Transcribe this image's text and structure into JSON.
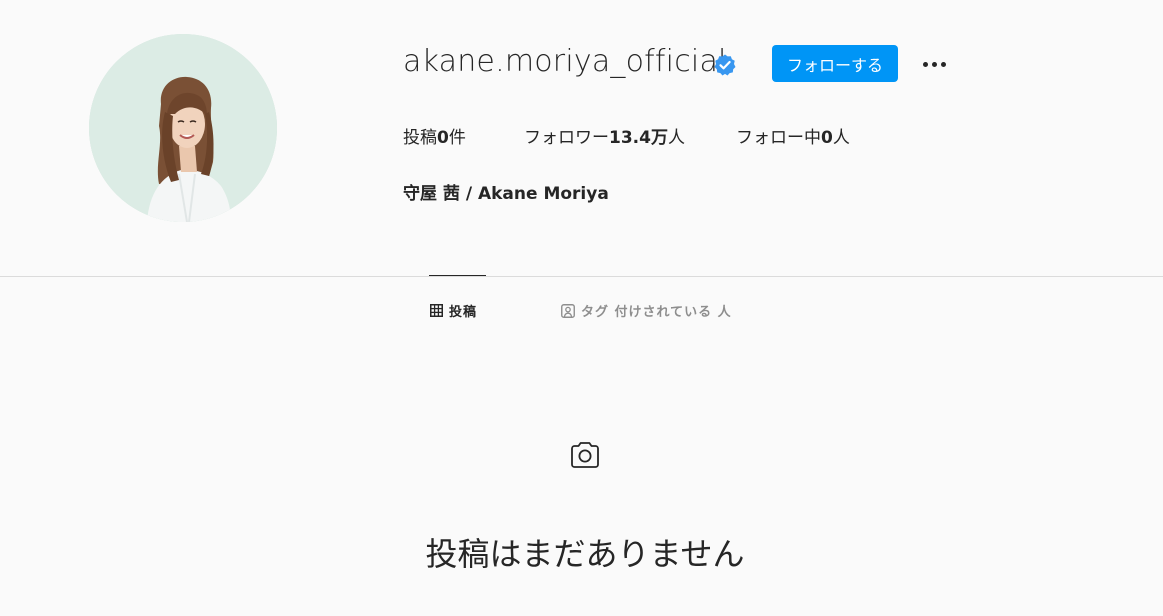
{
  "profile": {
    "username": "akane.moriya_official",
    "verified_icon": "verified-badge-icon",
    "follow_label": "フォローする",
    "more_icon": "more-options-icon",
    "stats": {
      "posts_label": "投稿",
      "posts_count": "0",
      "posts_unit": "件",
      "followers_label": "フォロワー",
      "followers_count": "13.4万",
      "followers_unit": "人",
      "following_label": "フォロー中",
      "following_count": "0",
      "following_unit": "人"
    },
    "full_name": "守屋 茜 / Akane Moriya"
  },
  "tabs": [
    {
      "label": "投稿",
      "icon": "grid-icon",
      "active": true
    },
    {
      "label": "タグ 付けされている 人",
      "icon": "tagged-user-icon",
      "active": false
    }
  ],
  "empty_state": {
    "icon": "camera-icon",
    "message": "投稿はまだありません"
  },
  "colors": {
    "accent": "#0095f6",
    "verified": "#3897f0",
    "background": "#fafafa",
    "text": "#262626",
    "muted": "#8e8e8e",
    "divider": "#dbdbdb"
  }
}
